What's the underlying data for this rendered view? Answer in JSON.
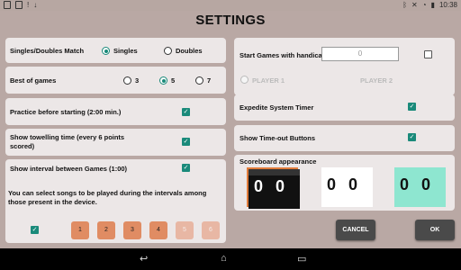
{
  "status": {
    "left_icons": [
      "app-icon",
      "app-icon",
      "notification-icon",
      "download-icon"
    ],
    "right_icons": [
      "bluetooth-icon",
      "mute-icon",
      "wifi-icon",
      "battery-icon"
    ],
    "time": "10:38"
  },
  "title": "SETTINGS",
  "match": {
    "label": "Singles/Doubles Match",
    "singles": "Singles",
    "doubles": "Doubles",
    "selected": "Singles"
  },
  "best_of": {
    "label": "Best of games",
    "options": [
      "3",
      "5",
      "7"
    ],
    "selected": "5"
  },
  "practice": {
    "label": "Practice before starting (2:00 min.)",
    "checked": true
  },
  "towelling": {
    "label": "Show towelling time (every 6 points scored)",
    "checked": true
  },
  "interval": {
    "label": "Show interval between Games (1:00)",
    "checked": true,
    "songs_text": "You can select songs to be played during the intervals among those present in the device.",
    "songs_checked": true,
    "songs": [
      "1",
      "2",
      "3",
      "4",
      "5",
      "6"
    ]
  },
  "handicap": {
    "label": "Start Games with handicap",
    "value": "0",
    "checked": false,
    "player1": "PLAYER 1",
    "player2": "PLAYER 2"
  },
  "expedite": {
    "label": "Expedite System Timer",
    "checked": true
  },
  "timeout": {
    "label": "Show Time-out Buttons",
    "checked": true
  },
  "scoreboard": {
    "label": "Scoreboard appearance",
    "themes": [
      {
        "name": "dark",
        "bg": "#111111",
        "digit": "#ffffff",
        "selected": true
      },
      {
        "name": "light",
        "bg": "#ffffff",
        "digit": "#111111",
        "selected": false
      },
      {
        "name": "mint",
        "bg": "#8ee6d0",
        "digit": "#111111",
        "selected": false
      }
    ],
    "score_left": "0",
    "score_right": "0"
  },
  "buttons": {
    "cancel": "CANCEL",
    "ok": "OK"
  },
  "colors": {
    "accent": "#1a8a7a",
    "song_on": "#e08c63",
    "selected_border": "#e07b3a"
  }
}
